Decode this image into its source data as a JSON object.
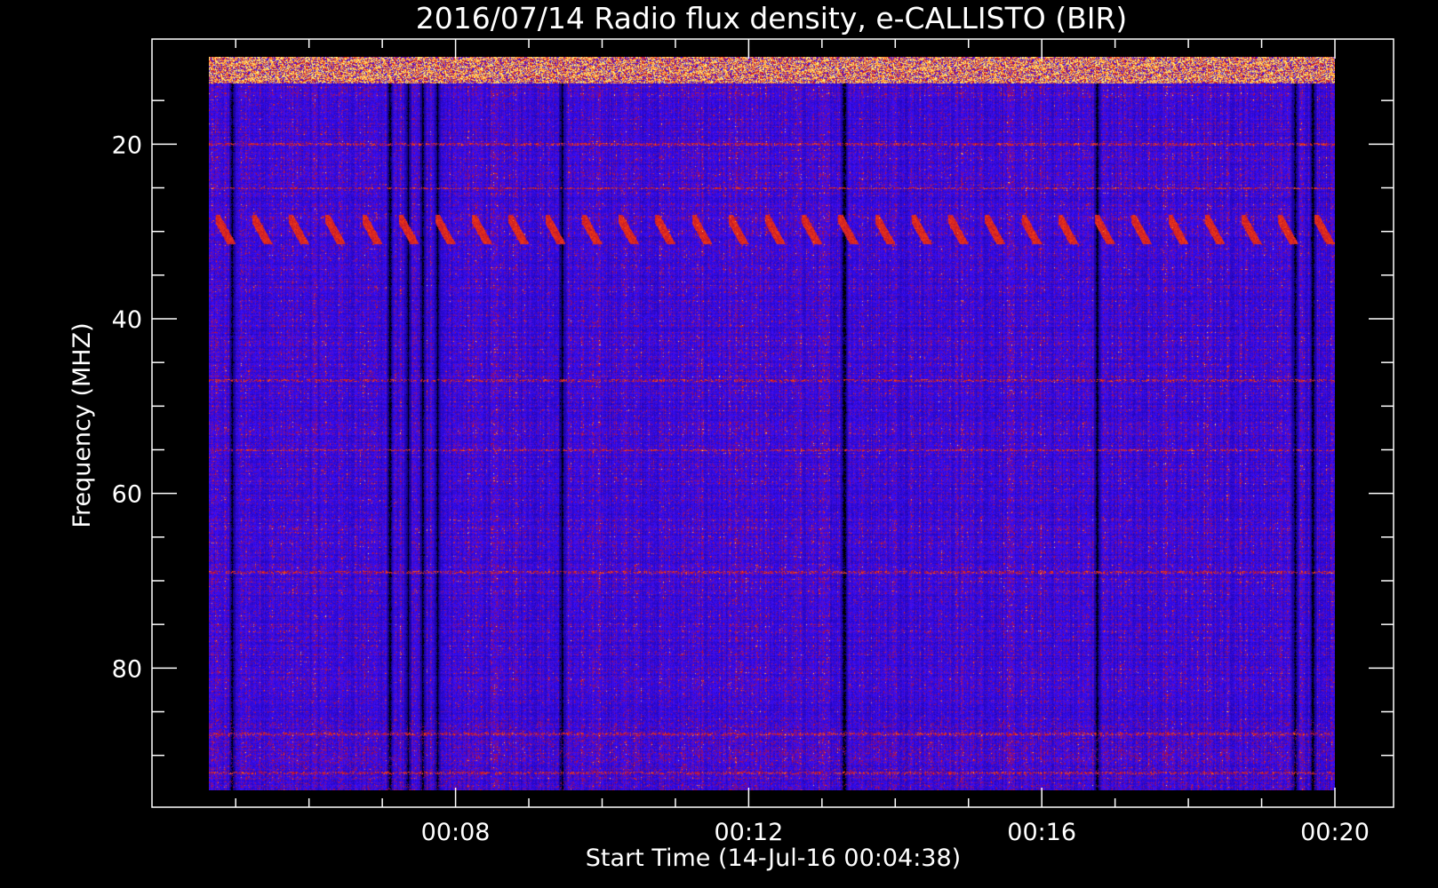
{
  "chart_data": {
    "type": "heatmap",
    "title": "2016/07/14  Radio flux density, e-CALLISTO (BIR)",
    "xlabel": "Start Time (14-Jul-16 00:04:38)",
    "ylabel": "Frequency (MHZ)",
    "x_axis": {
      "unit": "time HH:MM",
      "range": [
        "00:04:38",
        "00:20:00"
      ],
      "labeled_ticks": [
        "00:08",
        "00:12",
        "00:16",
        "00:20"
      ],
      "minor_tick_interval_minutes": 1
    },
    "y_axis": {
      "unit": "MHz",
      "range": [
        10,
        94
      ],
      "inverted": true,
      "labeled_ticks": [
        20,
        40,
        60,
        80
      ],
      "minor_tick_interval": 5
    },
    "colormap": [
      "#000000",
      "#1a00ff",
      "#4b10e0",
      "#b01020",
      "#ff5000",
      "#ffe060"
    ],
    "features": {
      "dark_vertical_bands_minutes": [
        4.95,
        7.1,
        7.35,
        7.55,
        7.75,
        9.45,
        13.3,
        16.75,
        19.45,
        19.7
      ],
      "periodic_drift_bursts": {
        "freq_start": 28.5,
        "freq_end": 31.0,
        "start_min": 4.72,
        "period_min": 0.5
      },
      "bright_band_frequency_range": [
        10,
        13
      ],
      "hot_frequency_lines": [
        20,
        25,
        47,
        55,
        69,
        87.5,
        92
      ]
    }
  }
}
